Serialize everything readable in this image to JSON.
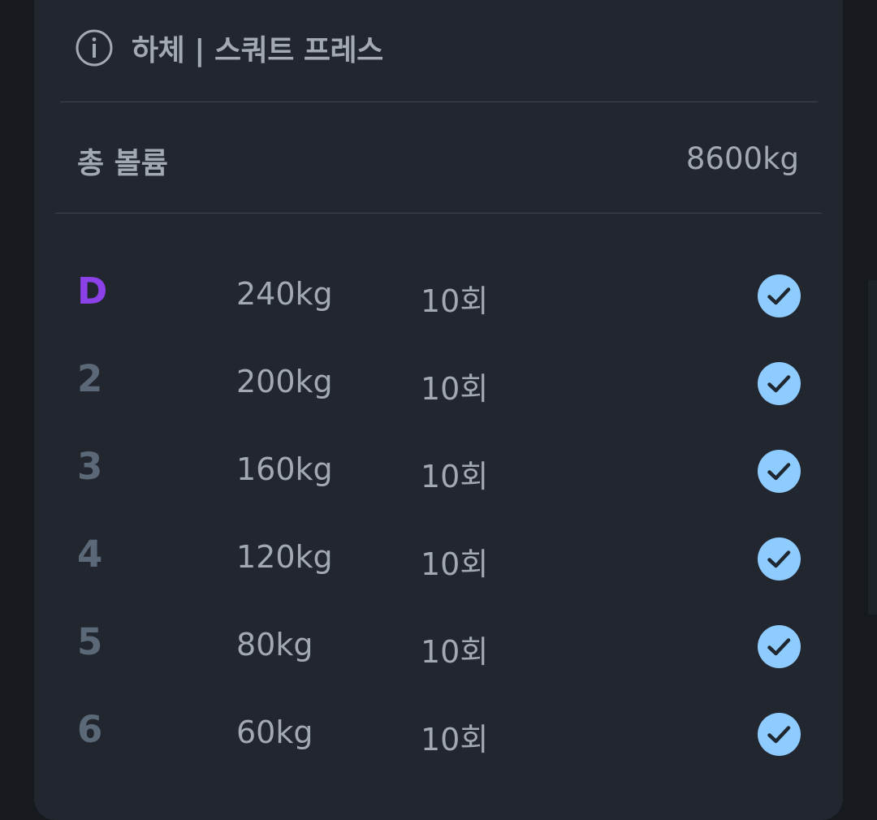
{
  "header": {
    "title": "하체 | 스쿼트 프레스",
    "icon": "info-icon"
  },
  "volume": {
    "label": "총 볼륨",
    "value": "8600kg"
  },
  "colors": {
    "card_bg": "#22262e",
    "text": "#a3a9b1",
    "drop_label": "#8b40e8",
    "set_label": "#5b6877",
    "check": "#8ecbff"
  },
  "sets": [
    {
      "label": "D",
      "weight": "240kg",
      "reps": "10회",
      "completed": true,
      "drop": true
    },
    {
      "label": "2",
      "weight": "200kg",
      "reps": "10회",
      "completed": true,
      "drop": false
    },
    {
      "label": "3",
      "weight": "160kg",
      "reps": "10회",
      "completed": true,
      "drop": false
    },
    {
      "label": "4",
      "weight": "120kg",
      "reps": "10회",
      "completed": true,
      "drop": false
    },
    {
      "label": "5",
      "weight": "80kg",
      "reps": "10회",
      "completed": true,
      "drop": false
    },
    {
      "label": "6",
      "weight": "60kg",
      "reps": "10회",
      "completed": true,
      "drop": false
    }
  ]
}
